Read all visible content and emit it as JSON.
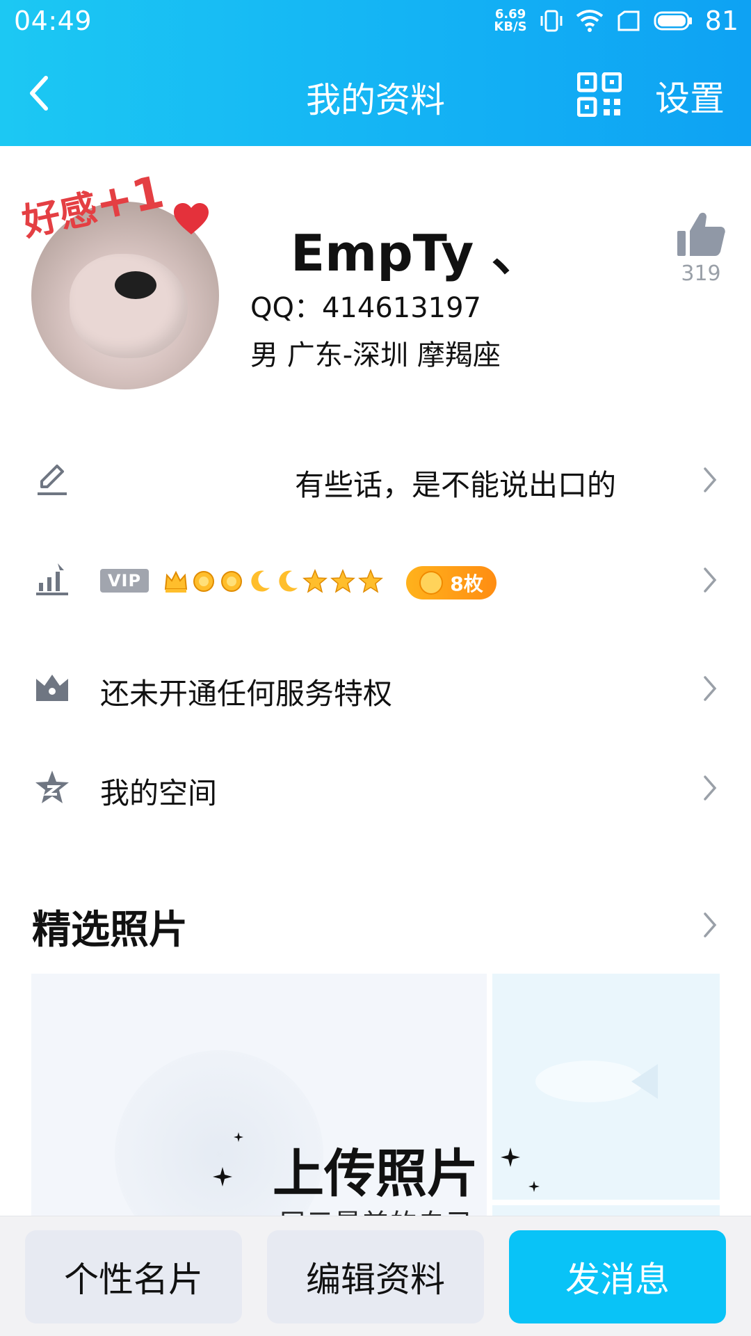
{
  "status_bar": {
    "time": "04:49",
    "net_speed_value": "6.69",
    "net_speed_unit": "KB/S",
    "battery": "81"
  },
  "app_bar": {
    "title": "我的资料",
    "settings_label": "设置"
  },
  "profile": {
    "avatar_sticker_text": "好感",
    "avatar_sticker_plus": "+1",
    "name": "EmpTy 、",
    "qq_line": "QQ：414613197",
    "info_line": "男  广东-深圳  摩羯座",
    "like_count": "319"
  },
  "rows": {
    "signature": "有些话，是不能说出口的",
    "vip_badge": "VIP",
    "medals": "8枚",
    "privilege": "还未开通任何服务特权",
    "space": "我的空间"
  },
  "photos": {
    "section_title": "精选照片",
    "upload_title": "上传照片",
    "upload_subtitle": "展示最美的自己"
  },
  "bottom_bar": {
    "card": "个性名片",
    "edit": "编辑资料",
    "message": "发消息"
  },
  "colors": {
    "header_gradient_start": "#1cc8f3",
    "header_gradient_end": "#0ea2f3",
    "primary_button": "#09c3f7",
    "medal_orange": "#ff9d16"
  }
}
